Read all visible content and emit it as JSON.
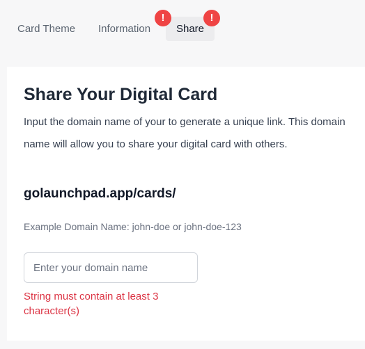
{
  "tabs": {
    "card_theme": "Card Theme",
    "information": "Information",
    "share": "Share",
    "alert_symbol": "!",
    "alert_color": "#ef4444"
  },
  "share": {
    "title": "Share Your Digital Card",
    "description": "Input the domain name of your to generate a unique link. This domain name will allow you to share your digital card with others.",
    "domain_prefix": "golaunchpad.app/cards/",
    "example": "Example Domain Name: john-doe or john-doe-123",
    "input": {
      "placeholder": "Enter your domain name",
      "value": ""
    },
    "error": "String must contain at least 3 character(s)",
    "error_color": "#dc3545"
  }
}
